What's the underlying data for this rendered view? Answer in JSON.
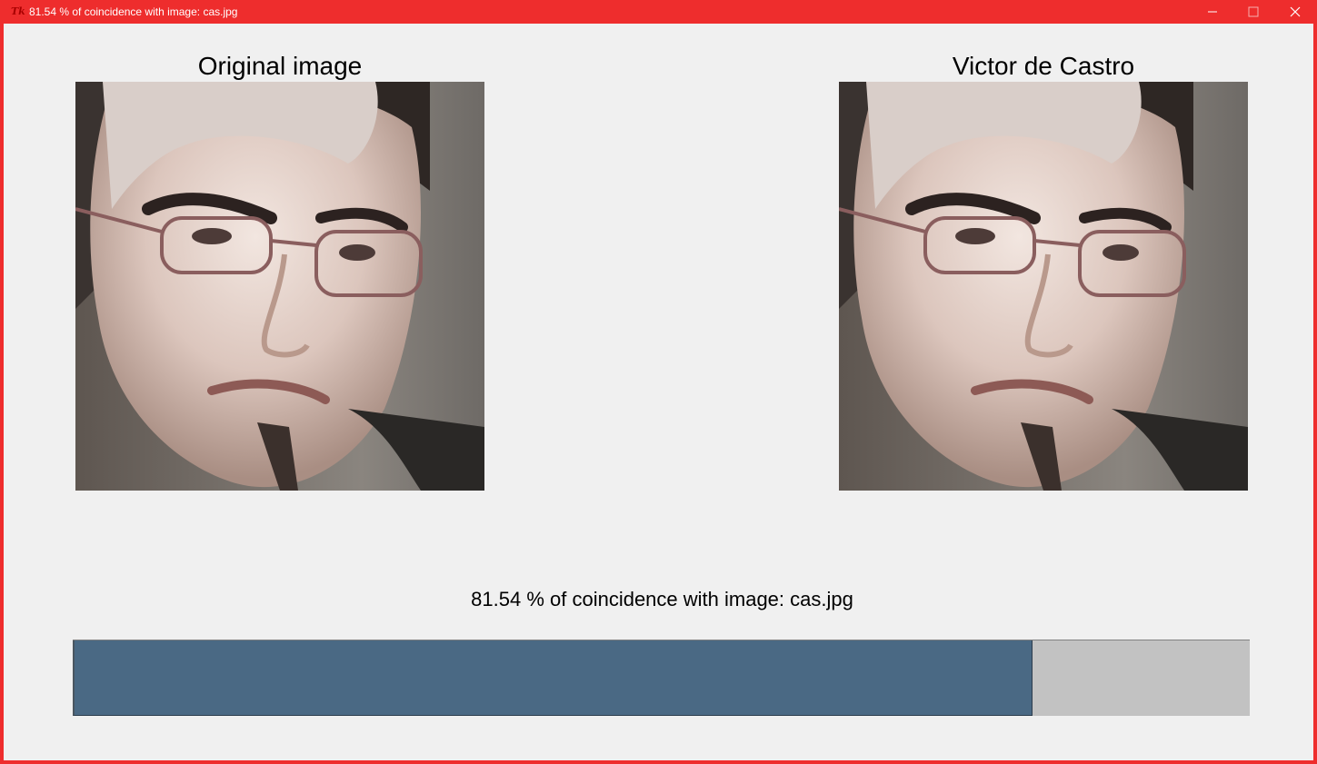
{
  "window": {
    "title": "81.54 % of coincidence with image: cas.jpg",
    "app_icon": "tk-feather-icon",
    "accent_color": "#ee2d2d"
  },
  "left_panel": {
    "caption": "Original image"
  },
  "right_panel": {
    "caption": "Victor de Castro"
  },
  "result": {
    "label": "81.54 % of coincidence with image: cas.jpg",
    "percent": 81.54,
    "bar_color": "#4a6984",
    "track_color": "#c2c2c2"
  }
}
